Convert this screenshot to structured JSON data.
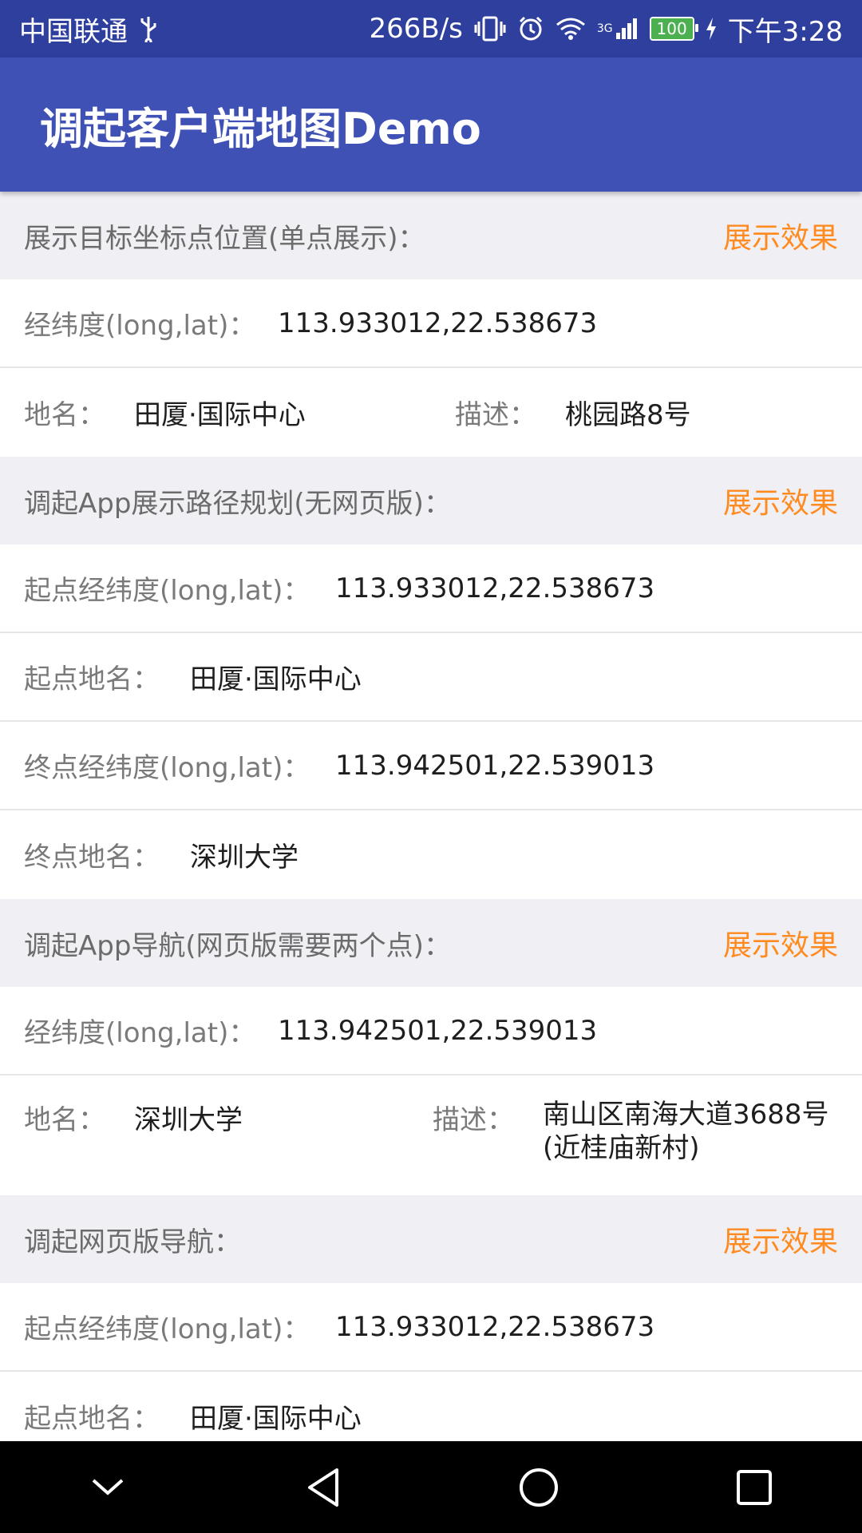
{
  "status_bar": {
    "carrier": "中国联通",
    "speed": "266B/s",
    "network": "3G",
    "battery": "100",
    "time": "下午3:28"
  },
  "app_bar": {
    "title": "调起客户端地图Demo"
  },
  "sections": {
    "s1": {
      "title": "展示目标坐标点位置(单点展示)：",
      "action": "展示效果",
      "coord_label": "经纬度(long,lat)：",
      "coord_value": "113.933012,22.538673",
      "name_label": "地名：",
      "name_value": "田厦·国际中心",
      "desc_label": "描述：",
      "desc_value": "桃园路8号"
    },
    "s2": {
      "title": "调起App展示路径规划(无网页版)：",
      "action": "展示效果",
      "start_coord_label": "起点经纬度(long,lat)：",
      "start_coord_value": "113.933012,22.538673",
      "start_name_label": "起点地名：",
      "start_name_value": "田厦·国际中心",
      "end_coord_label": "终点经纬度(long,lat)：",
      "end_coord_value": "113.942501,22.539013",
      "end_name_label": "终点地名：",
      "end_name_value": "深圳大学"
    },
    "s3": {
      "title": "调起App导航(网页版需要两个点)：",
      "action": "展示效果",
      "coord_label": "经纬度(long,lat)：",
      "coord_value": "113.942501,22.539013",
      "name_label": "地名：",
      "name_value": "深圳大学",
      "desc_label": "描述：",
      "desc_value_line1": "南山区南海大道3688号",
      "desc_value_line2": "(近桂庙新村)"
    },
    "s4": {
      "title": "调起网页版导航：",
      "action": "展示效果",
      "start_coord_label": "起点经纬度(long,lat)：",
      "start_coord_value": "113.933012,22.538673",
      "start_name_label": "起点地名：",
      "start_name_value": "田厦·国际中心"
    }
  },
  "colors": {
    "status_bar": "#2f3f9e",
    "app_bar": "#3f51b5",
    "section_bg": "#efeff4",
    "action": "#ff8a1f"
  },
  "nav_icons": [
    "chevron-down-icon",
    "back-icon",
    "home-icon",
    "recents-icon"
  ]
}
